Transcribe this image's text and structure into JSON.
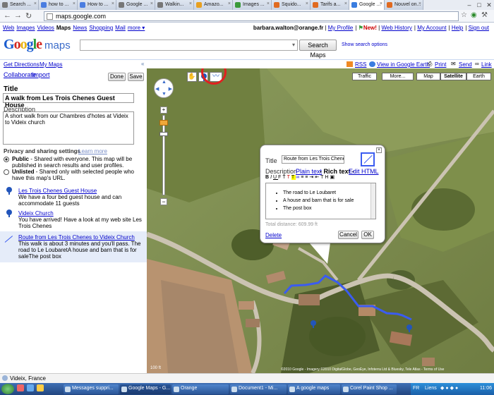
{
  "browser": {
    "tabs": [
      {
        "label": "Search ...",
        "active": false
      },
      {
        "label": "how to ...",
        "active": false
      },
      {
        "label": "How to ...",
        "active": false
      },
      {
        "label": "Google ...",
        "active": false
      },
      {
        "label": "Walkin...",
        "active": false
      },
      {
        "label": "Amazo...",
        "active": false
      },
      {
        "label": "Images ...",
        "active": false
      },
      {
        "label": "Squido...",
        "active": false
      },
      {
        "label": "Tarifs a...",
        "active": false
      },
      {
        "label": "Google ...",
        "active": true
      },
      {
        "label": "Nouvel on...",
        "active": false
      }
    ],
    "url": "maps.google.com"
  },
  "google_bar": {
    "left_links": [
      "Web",
      "Images",
      "Videos",
      "Maps",
      "News",
      "Shopping",
      "Mail",
      "more ▾"
    ],
    "active_link": "Maps",
    "user_email": "barbara.walton@orange.fr",
    "right_links": [
      "My Profile",
      "New!",
      "Web History",
      "My Account",
      "Help",
      "Sign out"
    ]
  },
  "logo": {
    "google": "Google",
    "maps": "maps"
  },
  "search": {
    "value": "",
    "button_label": "Search Maps",
    "options_link": "Show search options"
  },
  "subnav": {
    "get_directions": "Get Directions",
    "my_maps": "My Maps",
    "rss": "RSS",
    "view_in_earth": "View in Google Earth",
    "print": "Print",
    "send": "Send",
    "link": "Link"
  },
  "left_panel": {
    "collaborate": "Collaborate",
    "import": "Import",
    "done": "Done",
    "save": "Save",
    "title_label": "Title",
    "title_value": "A walk from Les Trois Chenes Guest House",
    "description_label": "Description",
    "description_value": "A short walk from our Chambres d'hotes at Videix to Videix church",
    "privacy_heading": "Privacy and sharing settings",
    "learn_more": "Learn more",
    "public_label": "Public",
    "public_desc": "- Shared with everyone. This map will be published in search results and user profiles.",
    "unlisted_label": "Unlisted",
    "unlisted_desc": "- Shared only with selected people who have this map's URL.",
    "items": [
      {
        "title": "Les Trois Chenes Guest House",
        "desc": "We have a four bed guest house and can accommodate 11 guests",
        "icon": "placemark-icon"
      },
      {
        "title": "Videix Church",
        "desc": "You have arrived! Have a look at my web site Les Trois Chenes",
        "icon": "placemark-icon"
      },
      {
        "title": "Route from Les Trois Chenes to Videix Church",
        "desc": "This walk is about 3 minutes and you'll pass. The road to Le LoubaretA house and barn that is for saleThe post box",
        "icon": "line-icon"
      }
    ],
    "location": "Videix, France"
  },
  "map": {
    "buttons": [
      "Traffic",
      "More...",
      "Map",
      "Satellite",
      "Earth"
    ],
    "selected": "Satellite",
    "copyright": "©2010 Google - Imagery ©2010 DigitalGlobe, GeoEye, Infoterra Ltd & Bluesky, Tele Atlas - Terms of Use",
    "scale": "100 ft"
  },
  "bubble": {
    "title_label": "Title",
    "title_value": "Route from Les Trois Chenes",
    "description_label": "Description",
    "plain_text": "Plain text",
    "rich_text": "- Rich text -",
    "edit_html": "Edit HTML",
    "bullets": [
      "The road to Le Loubaret",
      "A house and barn that is for sale",
      "The post box"
    ],
    "distance": "Total distance: 609.99 ft",
    "delete": "Delete",
    "cancel": "Cancel",
    "ok": "OK"
  },
  "taskbar": {
    "items": [
      "Messages suppri...",
      "Google Maps - G...",
      "Orange",
      "Document1 - Mi...",
      "A google maps",
      "Corel Paint Shop ..."
    ],
    "lang": "FR",
    "links": "Liens",
    "time": "11:06"
  },
  "colors": {
    "route": "#3b5cf0",
    "highlight_circle": "#e02020",
    "link": "#0000cc"
  }
}
